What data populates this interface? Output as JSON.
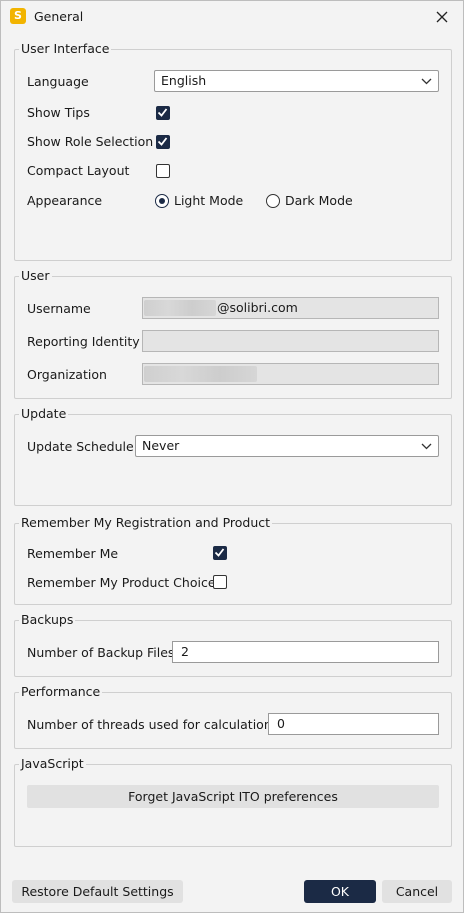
{
  "window": {
    "title": "General",
    "app_icon_letter": "S"
  },
  "user_interface": {
    "title": "User Interface",
    "language_label": "Language",
    "language_value": "English",
    "show_tips_label": "Show Tips",
    "show_tips_checked": true,
    "show_role_label": "Show Role Selection",
    "show_role_checked": true,
    "compact_label": "Compact Layout",
    "compact_checked": false,
    "appearance_label": "Appearance",
    "light_mode_label": "Light Mode",
    "dark_mode_label": "Dark Mode",
    "appearance_selected": "Light Mode"
  },
  "user": {
    "title": "User",
    "username_label": "Username",
    "username_value": "@solibri.com",
    "reporting_identity_label": "Reporting Identity",
    "reporting_identity_value": "",
    "organization_label": "Organization",
    "organization_value": ""
  },
  "update": {
    "title": "Update",
    "schedule_label": "Update Schedule",
    "schedule_value": "Never"
  },
  "remember": {
    "title": "Remember My Registration and Product",
    "remember_me_label": "Remember Me",
    "remember_me_checked": true,
    "product_choice_label": "Remember My Product Choice",
    "product_choice_checked": false
  },
  "backups": {
    "title": "Backups",
    "count_label": "Number of Backup Files",
    "count_value": "2"
  },
  "performance": {
    "title": "Performance",
    "threads_label": "Number of threads used for calculations",
    "threads_value": "0"
  },
  "javascript": {
    "title": "JavaScript",
    "forget_button": "Forget JavaScript ITO preferences"
  },
  "footer": {
    "restore_button": "Restore Default Settings",
    "ok_button": "OK",
    "cancel_button": "Cancel"
  },
  "colors": {
    "accent": "#1b2a45",
    "window_bg": "#f3f3f3",
    "app_icon": "#f2b400"
  },
  "icons": {
    "close": "close-icon",
    "dropdown": "chevron-down-icon",
    "check": "checkmark-icon"
  }
}
